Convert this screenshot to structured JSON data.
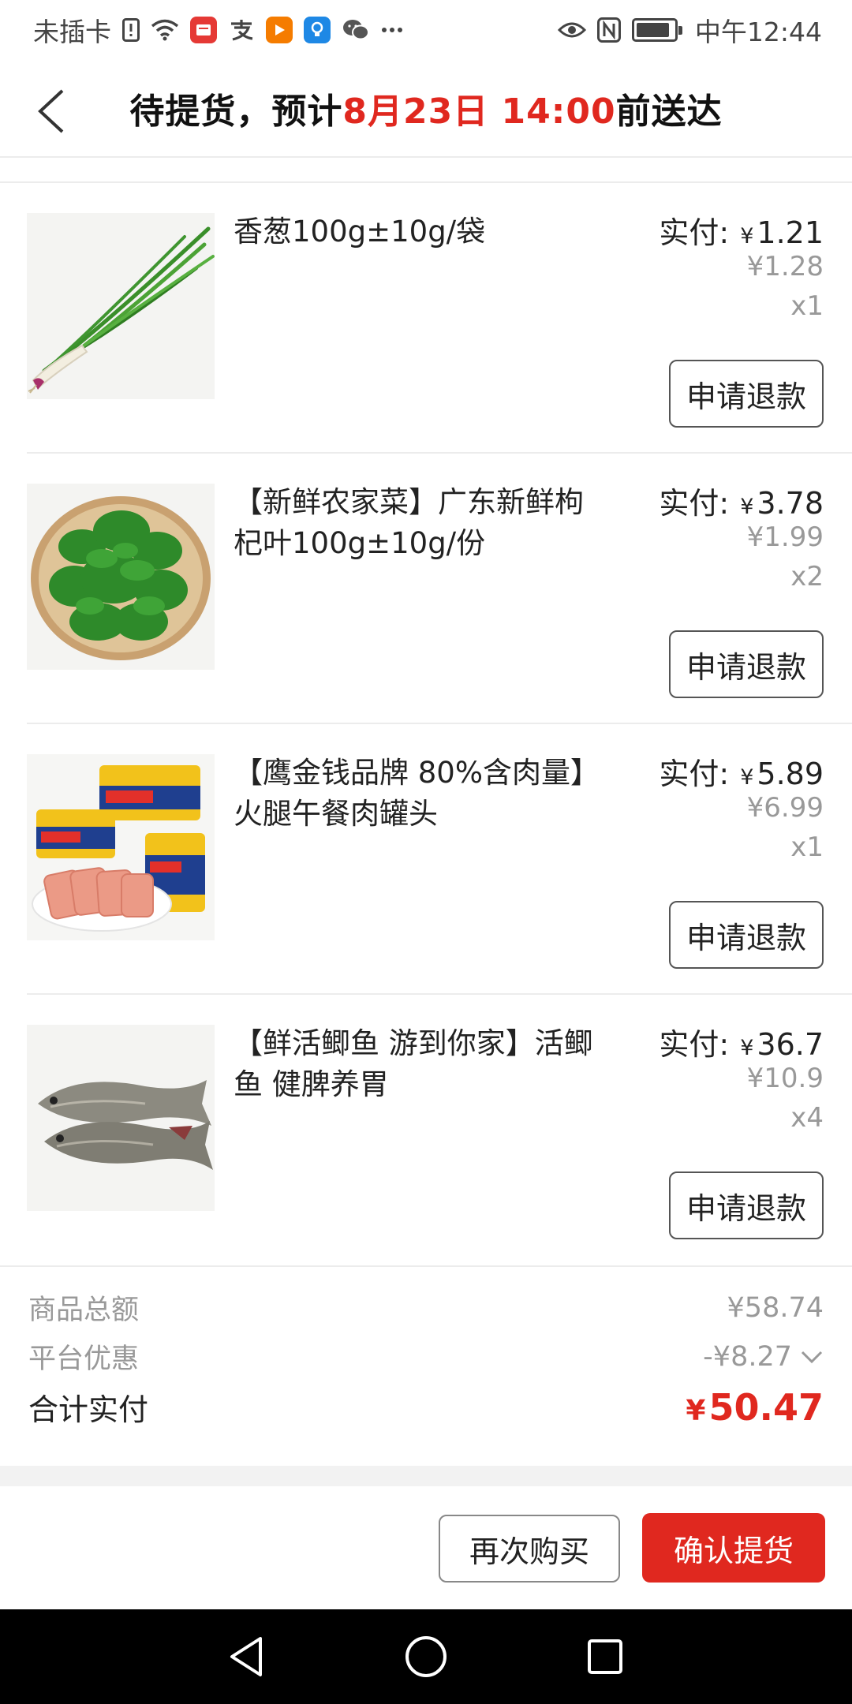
{
  "status_bar": {
    "carrier": "未插卡",
    "time": "中午12:44",
    "battery_level": 0.9,
    "app_icons": [
      "sim-alert-icon",
      "wifi-icon",
      "app-red-icon",
      "alipay-icon",
      "video-app-icon",
      "bulb-app-icon",
      "wechat-icon",
      "more-icon"
    ],
    "right_icons": [
      "eye-icon",
      "nfc-icon",
      "battery-icon"
    ]
  },
  "header": {
    "title_prefix": "待提货，预计",
    "title_highlight": "8月23日 14:00",
    "title_suffix": "前送达"
  },
  "items": [
    {
      "name": "香葱100g±10g/袋",
      "paid_label": "实付:",
      "paid_currency": "¥",
      "paid_amount": "1.21",
      "original_price": "¥1.28",
      "quantity": "x1",
      "refund_label": "申请退款",
      "thumb": "scallion"
    },
    {
      "name": "【新鲜农家菜】广东新鲜枸杞叶100g±10g/份",
      "paid_label": "实付:",
      "paid_currency": "¥",
      "paid_amount": "3.78",
      "original_price": "¥1.99",
      "quantity": "x2",
      "refund_label": "申请退款",
      "thumb": "goji-leaves"
    },
    {
      "name": "【鹰金钱品牌 80%含肉量】火腿午餐肉罐头",
      "paid_label": "实付:",
      "paid_currency": "¥",
      "paid_amount": "5.89",
      "original_price": "¥6.99",
      "quantity": "x1",
      "refund_label": "申请退款",
      "thumb": "luncheon-meat"
    },
    {
      "name": "【鲜活鲫鱼 游到你家】活鲫鱼 健脾养胃",
      "paid_label": "实付:",
      "paid_currency": "¥",
      "paid_amount": "36.7",
      "original_price": "¥10.9",
      "quantity": "x4",
      "refund_label": "申请退款",
      "thumb": "crucian-carp"
    }
  ],
  "summary": {
    "goods_total_label": "商品总额",
    "goods_total_value": "¥58.74",
    "discount_label": "平台优惠",
    "discount_value": "-¥8.27",
    "total_label": "合计实付",
    "total_currency": "¥",
    "total_value": "50.47"
  },
  "actions": {
    "buy_again": "再次购买",
    "confirm_pickup": "确认提货"
  },
  "colors": {
    "accent": "#e0281f",
    "muted": "#999999"
  }
}
